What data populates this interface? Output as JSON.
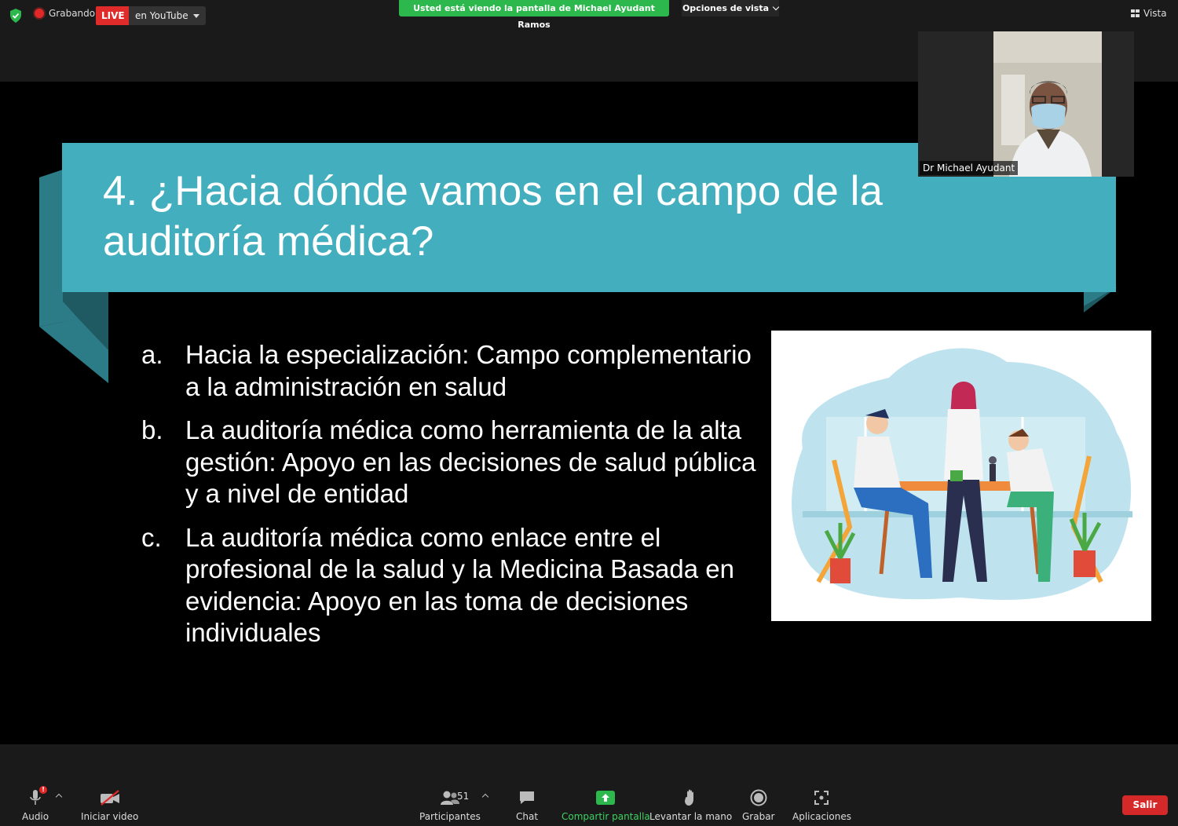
{
  "topbar": {
    "recording_label": "Grabando",
    "live_badge": "LIVE",
    "live_target": "en YouTube",
    "viewing_banner": "Usted está viendo la pantalla de Michael Ayudant Ramos",
    "view_options": "Opciones de vista",
    "view_button": "Vista"
  },
  "slide": {
    "title": "4. ¿Hacia dónde vamos en el campo de la auditoría médica?",
    "items": [
      {
        "marker": "a.",
        "text": "Hacia la especialización: Campo complementario a la administración en salud"
      },
      {
        "marker": "b.",
        "text": "La auditoría médica como herramienta de la alta gestión: Apoyo en las decisiones de salud pública y a nivel de entidad"
      },
      {
        "marker": "c.",
        "text": "La auditoría médica como enlace entre el profesional de la salud y la Medicina Basada en evidencia: Apoyo en las toma de decisiones individuales"
      }
    ],
    "accent_color": "#43aebd",
    "ribbon_color": "#2c7c87"
  },
  "self_video": {
    "participant_name": "Dr Michael Ayudant"
  },
  "toolbar": {
    "audio": "Audio",
    "audio_alert": "!",
    "video": "Iniciar video",
    "participants": "Participantes",
    "participants_count": "51",
    "chat": "Chat",
    "share": "Compartir pantalla",
    "raise_hand": "Levantar la mano",
    "record": "Grabar",
    "apps": "Aplicaciones",
    "leave": "Salir"
  }
}
